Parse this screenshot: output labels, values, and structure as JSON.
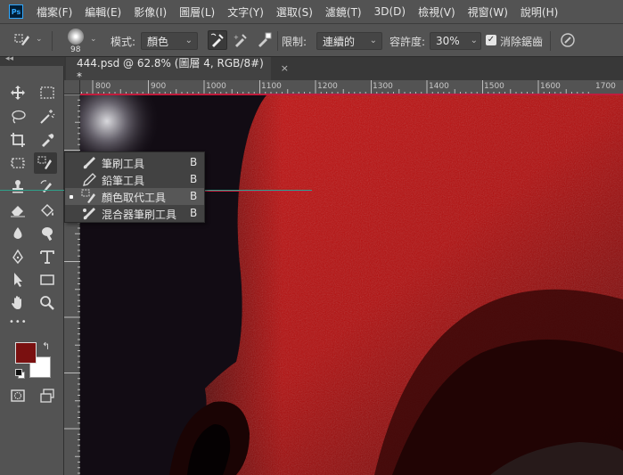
{
  "app": {
    "logo": "Ps"
  },
  "menu": [
    "檔案(F)",
    "編輯(E)",
    "影像(I)",
    "圖層(L)",
    "文字(Y)",
    "選取(S)",
    "濾鏡(T)",
    "3D(D)",
    "檢視(V)",
    "視窗(W)",
    "說明(H)"
  ],
  "options": {
    "brush_size": "98",
    "mode_label": "模式:",
    "mode_value": "顏色",
    "limit_label": "限制:",
    "limit_value": "連續的",
    "tolerance_label": "容許度:",
    "tolerance_value": "30%",
    "antialias_label": "消除鋸齒",
    "antialias_checked": true
  },
  "document_tab": {
    "title": "444.psd @ 62.8% (圖層 4, RGB/8#) *",
    "close": "×"
  },
  "toolbar": {
    "collapse": "◂◂",
    "more_tools": "•••"
  },
  "ruler": {
    "ticks": [
      "800",
      "900",
      "1000",
      "1100",
      "1200",
      "1300",
      "1400",
      "1500",
      "1600",
      "1700"
    ]
  },
  "flyout": {
    "items": [
      {
        "label": "筆刷工具",
        "key": "B",
        "selected": false
      },
      {
        "label": "鉛筆工具",
        "key": "B",
        "selected": false
      },
      {
        "label": "顏色取代工具",
        "key": "B",
        "selected": true
      },
      {
        "label": "混合器筆刷工具",
        "key": "B",
        "selected": false
      }
    ]
  },
  "colors": {
    "foreground": "#7a1010",
    "background": "#ffffff",
    "accent": "#31a8ff"
  }
}
